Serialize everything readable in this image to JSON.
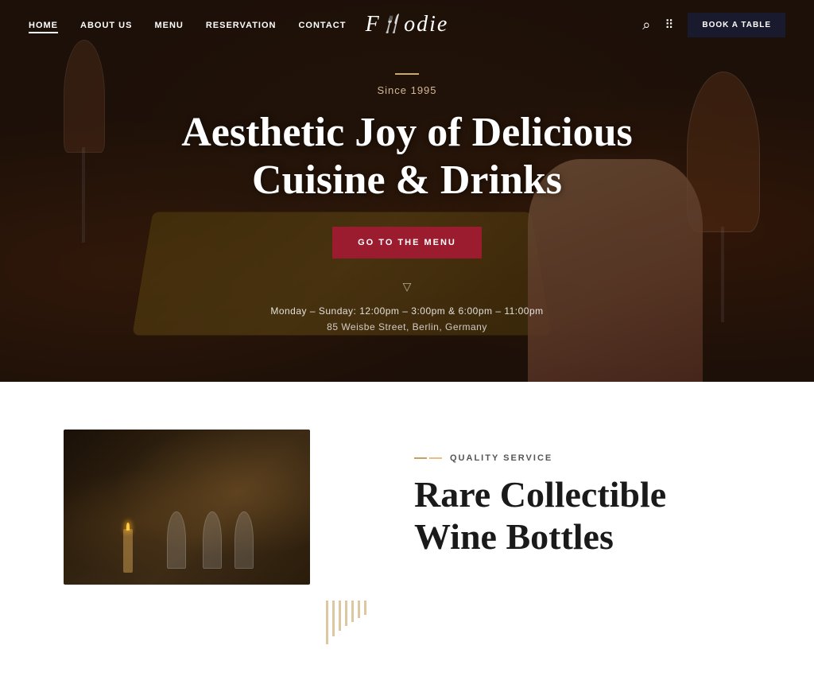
{
  "nav": {
    "links": [
      {
        "label": "HOME",
        "active": true
      },
      {
        "label": "ABOUT US",
        "active": false
      },
      {
        "label": "MENU",
        "active": false
      },
      {
        "label": "RESERVATION",
        "active": false
      },
      {
        "label": "CONTACT",
        "active": false
      }
    ],
    "logo": "Foodie",
    "book_btn": "BOOK A TABLE"
  },
  "hero": {
    "line_label": "—",
    "since": "Since 1995",
    "title_line1": "Aesthetic Joy of Delicious",
    "title_line2": "Cuisine & Drinks",
    "cta": "GO TO THE MENU",
    "chevron": "▽",
    "hours": "Monday – Sunday: 12:00pm – 3:00pm & 6:00pm – 11:00pm",
    "address": "85 Weisbe Street, Berlin, Germany"
  },
  "below": {
    "quality_label": "QUALITY SERVICE",
    "section_title_line1": "Rare Collectible",
    "section_title_line2": "Wine Bottles"
  },
  "hash_heights": [
    55,
    45,
    38,
    32,
    27,
    22,
    18
  ],
  "colors": {
    "accent_red": "#9b1c2e",
    "accent_gold": "#c8a060",
    "quality_line1": "#c8a060",
    "quality_line2": "#e8c080"
  }
}
